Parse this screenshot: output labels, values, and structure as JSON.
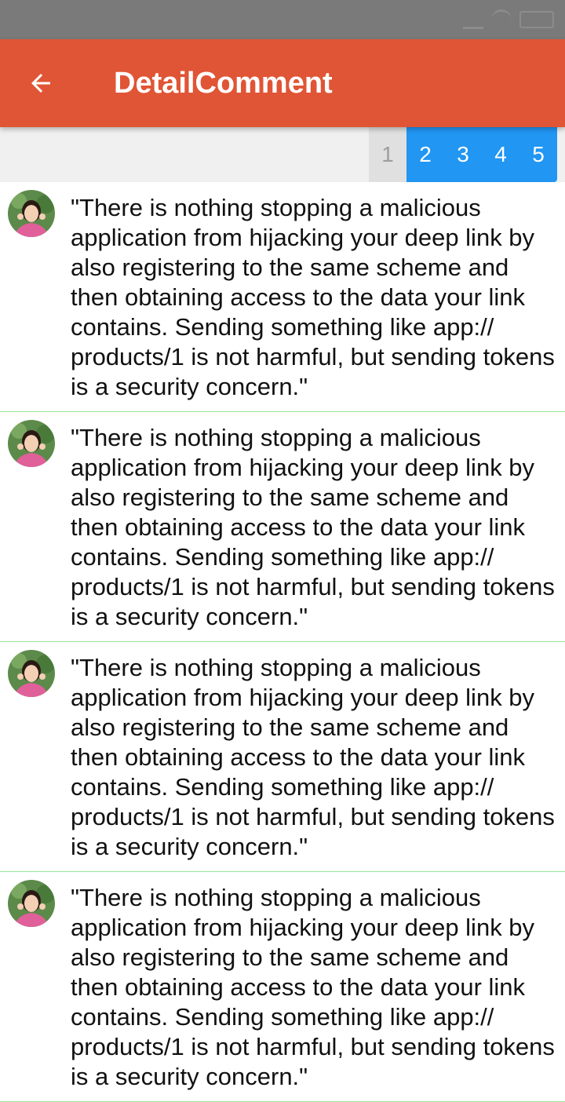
{
  "toolbar": {
    "title": "DetailComment",
    "back_icon": "arrow-left-icon"
  },
  "colors": {
    "appbar": "#e05535",
    "page_active": "#2196f3",
    "page_current": "#e0e0e0",
    "divider": "#9be39b"
  },
  "pagination": {
    "current_page": "1",
    "pages": [
      "1",
      "2",
      "3",
      "4",
      "5"
    ]
  },
  "comments": [
    {
      "avatar_icon": "user-avatar",
      "text": "\"There is nothing stopping a malicious application from hijacking your deep link by also registering to the same scheme and then obtaining access to the data your link contains. Sending something like app:// products/1 is not harmful, but sending tokens is a security concern.\""
    },
    {
      "avatar_icon": "user-avatar",
      "text": "\"There is nothing stopping a malicious application from hijacking your deep link by also registering to the same scheme and then obtaining access to the data your link contains. Sending something like app:// products/1 is not harmful, but sending tokens is a security concern.\""
    },
    {
      "avatar_icon": "user-avatar",
      "text": "\"There is nothing stopping a malicious application from hijacking your deep link by also registering to the same scheme and then obtaining access to the data your link contains. Sending something like app:// products/1 is not harmful, but sending tokens is a security concern.\""
    },
    {
      "avatar_icon": "user-avatar",
      "text": "\"There is nothing stopping a malicious application from hijacking your deep link by also registering to the same scheme and then obtaining access to the data your link contains. Sending something like app:// products/1 is not harmful, but sending tokens is a security concern.\""
    }
  ]
}
